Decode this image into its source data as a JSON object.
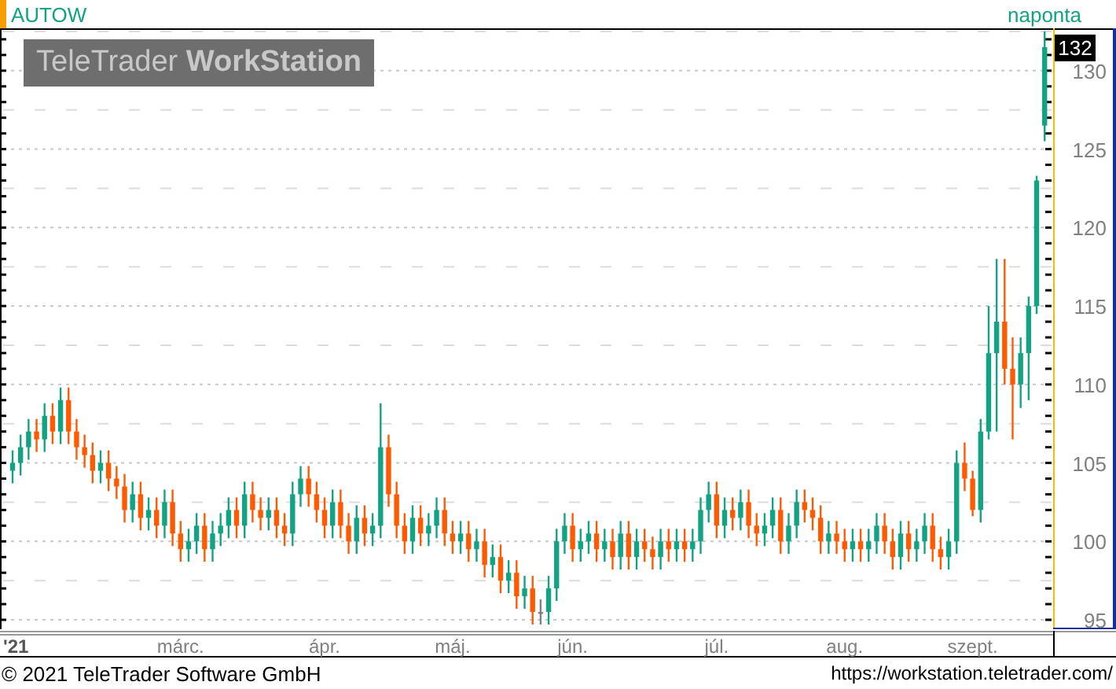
{
  "header": {
    "symbol": "AUTOW",
    "interval": "naponta"
  },
  "watermark": "TeleTrader **WorkStation**",
  "chart": {
    "last_price": "132",
    "chart_data": {
      "type": "candlestick",
      "grid": true,
      "ylim": [
        94.4,
        132.7
      ],
      "yticks": [
        130,
        125,
        120,
        115,
        110,
        105,
        100,
        95
      ],
      "categories": [
        "'21",
        null,
        null,
        null,
        null,
        null,
        null,
        null,
        null,
        null,
        null,
        null,
        null,
        null,
        null,
        null,
        null,
        null,
        null,
        null,
        null,
        "márc.",
        null,
        null,
        null,
        null,
        null,
        null,
        null,
        null,
        null,
        null,
        null,
        null,
        null,
        null,
        null,
        null,
        null,
        "ápr.",
        null,
        null,
        null,
        null,
        null,
        null,
        null,
        null,
        null,
        null,
        null,
        null,
        null,
        null,
        null,
        "máj.",
        null,
        null,
        null,
        null,
        null,
        null,
        null,
        null,
        null,
        null,
        null,
        null,
        null,
        null,
        "jún.",
        null,
        null,
        null,
        null,
        null,
        null,
        null,
        null,
        null,
        null,
        null,
        null,
        null,
        null,
        null,
        null,
        null,
        "júl.",
        null,
        null,
        null,
        null,
        null,
        null,
        null,
        null,
        null,
        null,
        null,
        null,
        null,
        null,
        null,
        "aug.",
        null,
        null,
        null,
        null,
        null,
        null,
        null,
        null,
        null,
        null,
        null,
        null,
        null,
        null,
        null,
        "szept.",
        null,
        null,
        null,
        null,
        null,
        null,
        null,
        null,
        null
      ],
      "ohlc": [
        [
          104.5,
          105.8,
          103.7,
          105
        ],
        [
          105,
          106.8,
          104.2,
          106
        ],
        [
          106,
          107.8,
          105.2,
          107
        ],
        [
          107,
          107.8,
          105.7,
          106.5
        ],
        [
          106.5,
          108.8,
          105.7,
          108
        ],
        [
          108,
          108.8,
          106.2,
          107
        ],
        [
          107,
          109.8,
          106.2,
          109
        ],
        [
          109,
          109.8,
          106.2,
          107
        ],
        [
          107,
          107.8,
          105.2,
          106
        ],
        [
          106,
          106.8,
          104.7,
          105.5
        ],
        [
          105.5,
          106.3,
          103.7,
          104.5
        ],
        [
          104.5,
          105.8,
          103.7,
          105
        ],
        [
          105,
          105.8,
          103.2,
          104
        ],
        [
          104,
          104.8,
          102.7,
          103.5
        ],
        [
          103.5,
          104.3,
          101.2,
          102
        ],
        [
          102,
          103.8,
          101.2,
          103
        ],
        [
          103,
          103.8,
          100.7,
          101.5
        ],
        [
          101.5,
          102.8,
          100.7,
          102
        ],
        [
          102,
          102.8,
          100.2,
          101
        ],
        [
          101,
          103.3,
          100.2,
          102.5
        ],
        [
          102.5,
          103.3,
          99.7,
          100.5
        ],
        [
          100.5,
          101.3,
          98.7,
          99.5
        ],
        [
          99.5,
          100.8,
          98.7,
          100
        ],
        [
          100,
          101.8,
          99.2,
          101
        ],
        [
          101,
          101.8,
          98.7,
          99.5
        ],
        [
          99.5,
          101.3,
          98.7,
          100.5
        ],
        [
          100.5,
          101.8,
          99.7,
          101
        ],
        [
          101,
          102.8,
          100.2,
          102
        ],
        [
          102,
          102.8,
          100.2,
          101
        ],
        [
          101,
          103.8,
          100.2,
          103
        ],
        [
          103,
          103.8,
          101.2,
          102
        ],
        [
          102,
          102.8,
          100.7,
          101.5
        ],
        [
          101.5,
          102.8,
          100.7,
          102
        ],
        [
          102,
          102.8,
          100.2,
          101
        ],
        [
          101,
          101.8,
          99.7,
          100.5
        ],
        [
          100.5,
          103.8,
          99.7,
          103
        ],
        [
          103,
          104.8,
          102.2,
          104
        ],
        [
          104,
          104.8,
          102.2,
          103
        ],
        [
          103,
          103.8,
          101.2,
          102
        ],
        [
          102,
          102.8,
          100.2,
          101
        ],
        [
          101,
          103.3,
          100.2,
          102.5
        ],
        [
          102.5,
          103.3,
          100.2,
          101
        ],
        [
          101,
          101.8,
          99.2,
          100
        ],
        [
          100,
          102.3,
          99.2,
          101.5
        ],
        [
          101.5,
          102.3,
          99.7,
          100.5
        ],
        [
          100.5,
          101.8,
          99.7,
          101
        ],
        [
          101,
          108.8,
          100.2,
          106
        ],
        [
          106,
          106.8,
          102.2,
          103
        ],
        [
          103,
          103.8,
          100.2,
          101
        ],
        [
          101,
          101.8,
          99.2,
          100
        ],
        [
          100,
          102.3,
          99.2,
          101.5
        ],
        [
          101.5,
          102.3,
          99.7,
          100.5
        ],
        [
          100.5,
          101.8,
          99.7,
          101
        ],
        [
          101,
          102.8,
          100.2,
          102
        ],
        [
          102,
          102.8,
          99.7,
          100.5
        ],
        [
          100.5,
          101.3,
          99.2,
          100
        ],
        [
          100,
          101.3,
          99.2,
          100.5
        ],
        [
          100.5,
          101.3,
          98.7,
          99.5
        ],
        [
          99.5,
          100.8,
          98.7,
          100
        ],
        [
          100,
          100.8,
          97.7,
          98.5
        ],
        [
          98.5,
          99.8,
          97.7,
          99
        ],
        [
          99,
          99.8,
          96.7,
          97.5
        ],
        [
          97.5,
          98.8,
          96.7,
          98
        ],
        [
          98,
          98.8,
          95.7,
          96.5
        ],
        [
          96.5,
          97.8,
          95.7,
          97
        ],
        [
          97,
          97.8,
          94.7,
          95.5
        ],
        [
          95.5,
          96.3,
          94.7,
          95.5
        ],
        [
          95.5,
          97.8,
          94.7,
          97
        ],
        [
          97,
          100.8,
          96.2,
          100
        ],
        [
          100,
          101.8,
          99.2,
          101
        ],
        [
          101,
          101.8,
          98.7,
          99.5
        ],
        [
          99.5,
          100.8,
          98.7,
          100
        ],
        [
          100,
          101.3,
          99.2,
          100.5
        ],
        [
          100.5,
          101.3,
          98.7,
          99.5
        ],
        [
          99.5,
          100.8,
          98.7,
          100
        ],
        [
          100,
          100.8,
          98.2,
          99
        ],
        [
          99,
          101.3,
          98.2,
          100.5
        ],
        [
          100.5,
          101.3,
          98.2,
          99
        ],
        [
          99,
          100.8,
          98.2,
          100
        ],
        [
          100,
          100.8,
          98.7,
          99.5
        ],
        [
          99.5,
          100.3,
          98.2,
          99
        ],
        [
          99,
          100.8,
          98.2,
          100
        ],
        [
          100,
          100.8,
          98.7,
          99.5
        ],
        [
          99.5,
          100.8,
          98.7,
          100
        ],
        [
          100,
          100.8,
          98.7,
          99.5
        ],
        [
          99.5,
          100.8,
          98.7,
          100
        ],
        [
          100,
          102.8,
          99.2,
          102
        ],
        [
          102,
          103.8,
          101.2,
          103
        ],
        [
          103,
          103.8,
          100.2,
          101
        ],
        [
          101,
          102.8,
          100.2,
          102
        ],
        [
          102,
          102.8,
          100.7,
          101.5
        ],
        [
          101.5,
          103.3,
          100.7,
          102.5
        ],
        [
          102.5,
          103.3,
          100.2,
          101
        ],
        [
          101,
          101.8,
          99.7,
          100.5
        ],
        [
          100.5,
          101.8,
          99.7,
          101
        ],
        [
          101,
          102.8,
          100.2,
          102
        ],
        [
          102,
          102.8,
          99.2,
          100
        ],
        [
          100,
          101.8,
          99.2,
          101
        ],
        [
          101,
          103.3,
          100.2,
          102.5
        ],
        [
          102.5,
          103.3,
          101.2,
          102
        ],
        [
          102,
          102.8,
          100.7,
          101.5
        ],
        [
          101.5,
          102.3,
          99.2,
          100
        ],
        [
          100,
          101.3,
          99.2,
          100.5
        ],
        [
          100.5,
          101.3,
          99.2,
          100
        ],
        [
          100,
          100.8,
          98.7,
          99.5
        ],
        [
          99.5,
          100.8,
          98.7,
          100
        ],
        [
          100,
          100.8,
          98.7,
          99.5
        ],
        [
          99.5,
          100.8,
          98.7,
          100
        ],
        [
          100,
          101.8,
          99.2,
          101
        ],
        [
          101,
          101.8,
          99.2,
          100
        ],
        [
          100,
          100.8,
          98.2,
          99
        ],
        [
          99,
          101.3,
          98.2,
          100.5
        ],
        [
          100.5,
          101.3,
          98.7,
          99.5
        ],
        [
          99.5,
          100.8,
          98.7,
          100
        ],
        [
          100,
          101.8,
          99.2,
          101
        ],
        [
          101,
          101.8,
          98.7,
          99.5
        ],
        [
          99.5,
          100.3,
          98.2,
          99
        ],
        [
          99,
          100.8,
          98.2,
          100
        ],
        [
          100,
          105.8,
          99.2,
          105
        ],
        [
          105,
          106.3,
          103.2,
          104
        ],
        [
          104,
          104.5,
          101.6,
          102
        ],
        [
          102,
          107.8,
          101.2,
          107
        ],
        [
          107,
          115,
          106.5,
          112
        ],
        [
          112,
          118,
          107,
          114
        ],
        [
          114,
          118,
          110,
          111
        ],
        [
          111,
          113,
          106.5,
          110
        ],
        [
          110,
          113,
          108.5,
          112
        ],
        [
          112,
          115.6,
          109,
          115
        ],
        [
          115,
          123.3,
          114.5,
          123
        ],
        [
          126.5,
          132.5,
          125.5,
          131.5
        ]
      ]
    }
  },
  "footer": {
    "copyright": "© 2021 TeleTrader Software GmbH",
    "url": "https://workstation.teletrader.com/"
  }
}
